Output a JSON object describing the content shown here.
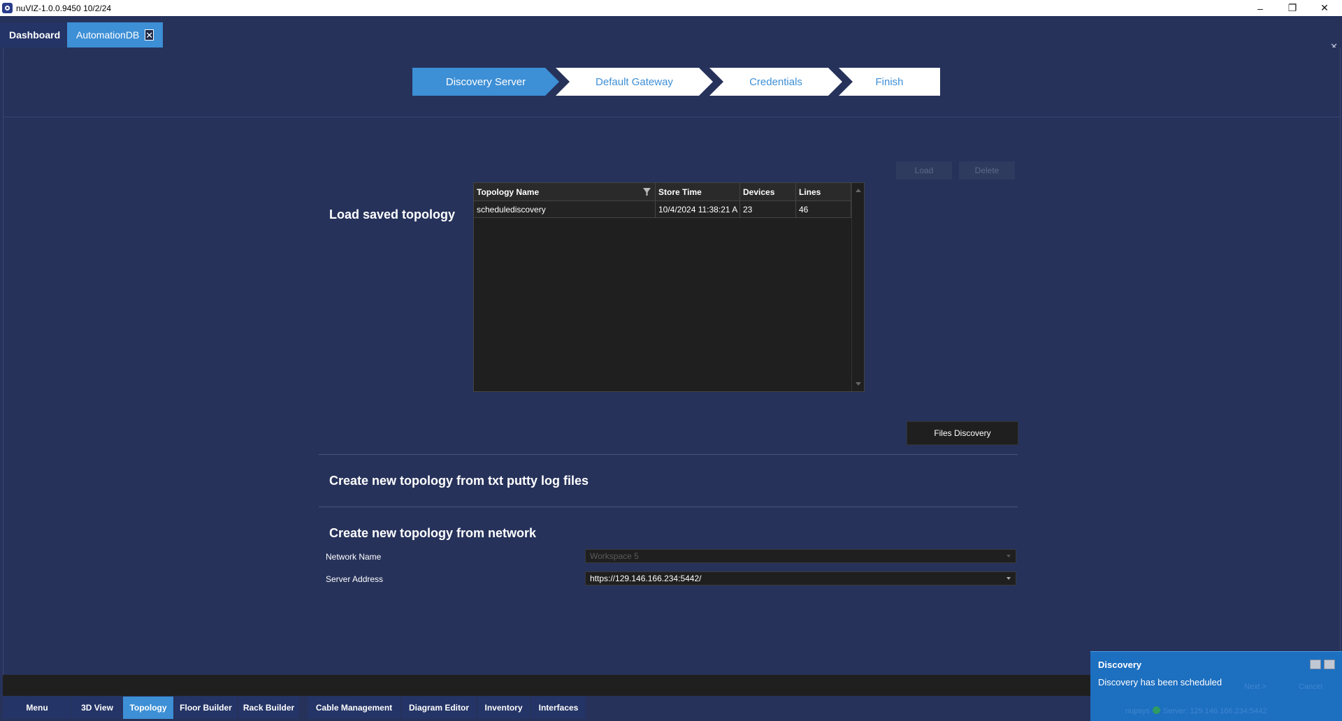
{
  "window": {
    "title": "nuVIZ-1.0.0.9450 10/2/24",
    "minimize": "–",
    "restore": "❐",
    "close": "✕"
  },
  "doc_tabs": [
    {
      "label": "Dashboard"
    },
    {
      "label": "AutomationDB",
      "close": "✕"
    }
  ],
  "close_all": "✕",
  "wizard": {
    "steps": [
      {
        "label": "Discovery Server",
        "active": true
      },
      {
        "label": "Default Gateway"
      },
      {
        "label": "Credentials"
      },
      {
        "label": "Finish"
      }
    ]
  },
  "load_section": {
    "title": "Load saved topology",
    "load_button": "Load",
    "delete_button": "Delete",
    "columns": [
      "Topology Name",
      "Store Time",
      "Devices",
      "Lines"
    ],
    "rows": [
      [
        "schedulediscovery",
        "10/4/2024 11:38:21 A",
        "23",
        "46"
      ]
    ]
  },
  "files_section": {
    "title": "Create new topology from txt putty log files",
    "button": "Files Discovery"
  },
  "network_section": {
    "title": "Create new topology from network",
    "network_name_label": "Network Name",
    "network_name_value": "Workspace 5",
    "server_address_label": "Server Address",
    "server_address_value": "https://129.146.166.234:5442/"
  },
  "bottom_tabs": [
    {
      "label": "Menu"
    },
    {
      "label": "3D View"
    },
    {
      "label": "Topology",
      "active": true
    },
    {
      "label": "Floor Builder"
    },
    {
      "label": "Rack Builder"
    },
    {
      "label": "Cable Management"
    },
    {
      "label": "Diagram Editor"
    },
    {
      "label": "Inventory"
    },
    {
      "label": "Interfaces"
    }
  ],
  "toast": {
    "title": "Discovery",
    "message": "Discovery has been scheduled",
    "next": "Next >",
    "cancel": "Cancel",
    "status_user": "nupsys",
    "status_server": "Server: 129.146.166.234:5442"
  },
  "colors": {
    "background": "#26325a",
    "accent": "#3d8fd6",
    "grid_bg": "#1f1f1f"
  }
}
